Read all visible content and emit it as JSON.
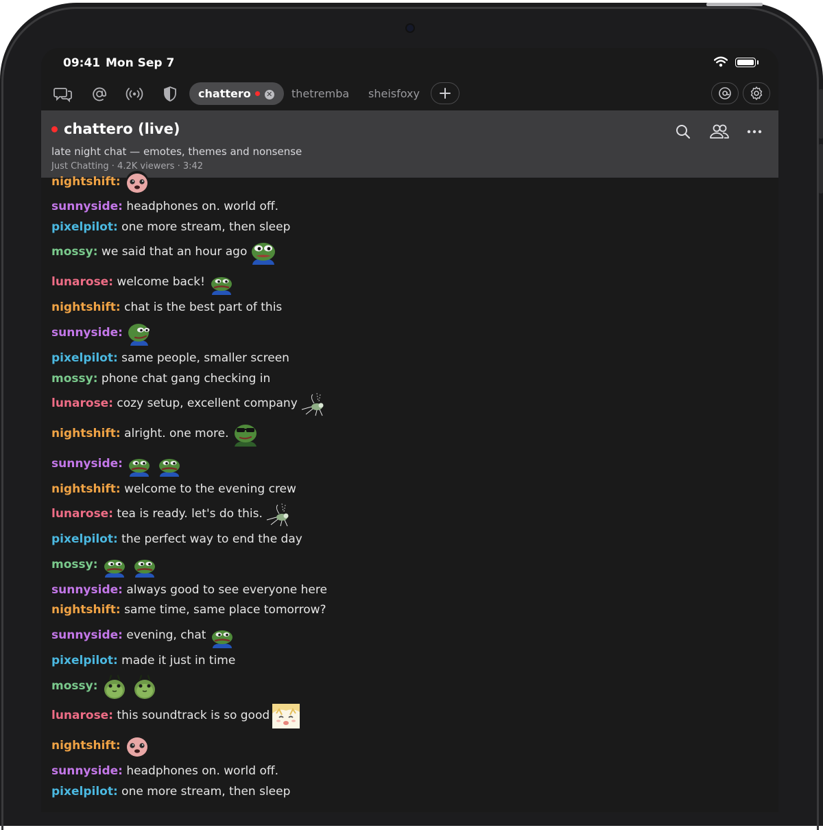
{
  "status_bar": {
    "time": "09:41",
    "date": "Mon Sep 7"
  },
  "tabs": [
    {
      "label": "chattero",
      "active": true,
      "live": true
    },
    {
      "label": "thetremba",
      "active": false
    },
    {
      "label": "sheisfoxy",
      "active": false
    }
  ],
  "toolbar_icons": [
    "chats-icon",
    "mentions-icon",
    "live-icon",
    "shield-icon",
    "add-tab-icon",
    "account-icon",
    "settings-icon"
  ],
  "channel": {
    "title": "chattero (live)",
    "subtitle": "late night chat — emotes, themes and nonsense",
    "meta": "Just Chatting · 4.2K viewers · 3:42",
    "actions": [
      "search-icon",
      "users-icon",
      "more-icon"
    ]
  },
  "messages": [
    {
      "user": "nightshift",
      "text": "",
      "emotes": [
        "blob-emote"
      ]
    },
    {
      "user": "sunnyside",
      "text": "headphones on. world off.",
      "emotes": []
    },
    {
      "user": "pixelpilot",
      "text": "one more stream, then sleep",
      "emotes": []
    },
    {
      "user": "mossy",
      "text": "we said that an hour ago",
      "emotes": [
        "pepe-emote"
      ]
    },
    {
      "user": "lunarose",
      "text": "welcome back!",
      "emotes": [
        "pepe-sad-emote"
      ]
    },
    {
      "user": "nightshift",
      "text": "chat is the best part of this",
      "emotes": []
    },
    {
      "user": "sunnyside",
      "text": "",
      "emotes": [
        "pepe-smug-emote"
      ]
    },
    {
      "user": "pixelpilot",
      "text": "same people, smaller screen",
      "emotes": []
    },
    {
      "user": "mossy",
      "text": "phone chat gang checking in",
      "emotes": []
    },
    {
      "user": "lunarose",
      "text": "cozy setup, excellent company",
      "emotes": [
        "mosquito-emote"
      ]
    },
    {
      "user": "nightshift",
      "text": "alright. one more.",
      "emotes": [
        "pepe-glasses-emote"
      ]
    },
    {
      "user": "sunnyside",
      "text": "",
      "emotes": [
        "pepe-sad-emote",
        "pepe-sad-emote"
      ]
    },
    {
      "user": "nightshift",
      "text": "welcome to the evening crew",
      "emotes": []
    },
    {
      "user": "lunarose",
      "text": "tea is ready. let's do this.",
      "emotes": [
        "mosquito-emote"
      ]
    },
    {
      "user": "pixelpilot",
      "text": "the perfect way to end the day",
      "emotes": []
    },
    {
      "user": "mossy",
      "text": "",
      "emotes": [
        "pepe-sad-emote",
        "pepe-sad-emote"
      ]
    },
    {
      "user": "sunnyside",
      "text": "always good to see everyone here",
      "emotes": []
    },
    {
      "user": "nightshift",
      "text": "same time, same place tomorrow?",
      "emotes": []
    },
    {
      "user": "sunnyside",
      "text": "evening, chat",
      "emotes": [
        "pepe-sad-emote"
      ]
    },
    {
      "user": "pixelpilot",
      "text": "made it just in time",
      "emotes": []
    },
    {
      "user": "mossy",
      "text": "",
      "emotes": [
        "bug-emote",
        "bug-emote"
      ]
    },
    {
      "user": "lunarose",
      "text": "this soundtrack is so good",
      "emotes": [
        "anime-emote"
      ]
    },
    {
      "user": "nightshift",
      "text": "",
      "emotes": [
        "blob-emote"
      ]
    },
    {
      "user": "sunnyside",
      "text": "headphones on. world off.",
      "emotes": []
    },
    {
      "user": "pixelpilot",
      "text": "one more stream, then sleep",
      "emotes": []
    }
  ],
  "colors": {
    "nightshift": "#f0a345",
    "sunnyside": "#c377e8",
    "pixelpilot": "#4bb8e0",
    "mossy": "#7ac98c",
    "lunarose": "#ee6d86",
    "live": "#ff2d2d",
    "header_bg": "#3d3d3f",
    "chat_bg": "#1a1a1a"
  }
}
